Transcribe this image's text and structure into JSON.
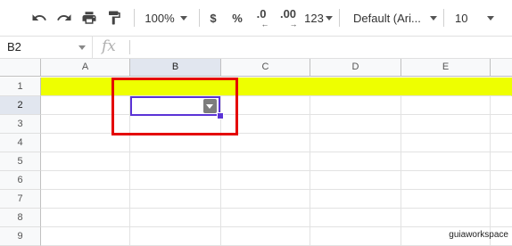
{
  "toolbar": {
    "zoom": "100%",
    "currency": "$",
    "percent": "%",
    "decrease_decimals": ".0",
    "increase_decimals": ".00",
    "more_formats": "123",
    "font": "Default (Ari...",
    "font_size": "10"
  },
  "formula_bar": {
    "name_box": "B2",
    "fx": "fx",
    "value": ""
  },
  "grid": {
    "columns": [
      "A",
      "B",
      "C",
      "D",
      "E"
    ],
    "rows": [
      "1",
      "2",
      "3",
      "4",
      "5",
      "6",
      "7",
      "8",
      "9"
    ],
    "selected_column": "B",
    "selected_row": "2"
  },
  "colors": {
    "row1_fill": "#eeff00",
    "selection": "#5b33d6",
    "highlight": "#e40000"
  },
  "watermark": "guiaworkspace"
}
